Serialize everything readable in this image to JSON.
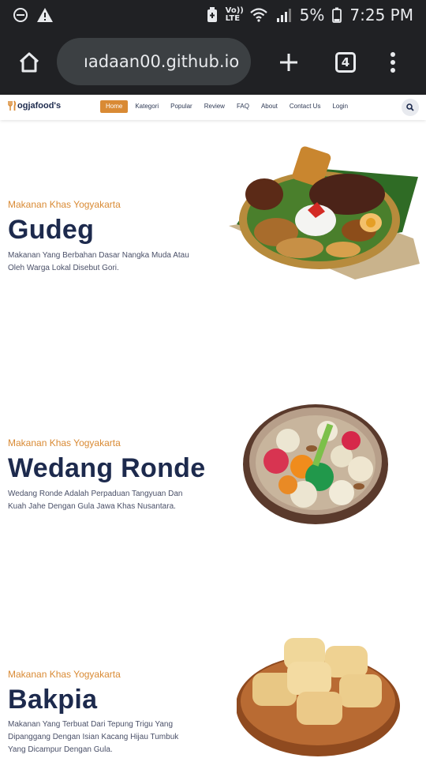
{
  "status_bar": {
    "time": "7:25 PM",
    "battery": "5%",
    "network": "Vo)) LTE",
    "icons": [
      "do-not-disturb-icon",
      "warning-icon",
      "battery-saver-icon",
      "wifi-icon",
      "signal-icon",
      "battery-icon"
    ]
  },
  "browser": {
    "url": "ıadaan00.github.io",
    "tab_count": "4",
    "icons": [
      "home-icon",
      "lock-icon",
      "new-tab-icon",
      "menu-icon"
    ]
  },
  "site": {
    "logo_text": "ogjafood's",
    "nav": [
      "Home",
      "Kategori",
      "Popular",
      "Review",
      "FAQ",
      "About",
      "Contact Us",
      "Login"
    ],
    "active_nav": "Home",
    "accent": "#d98a34",
    "heading_color": "#1d2a4d"
  },
  "sections": [
    {
      "subtitle": "Makanan Khas Yogyakarta",
      "title": "Gudeg",
      "desc_lines": [
        "Makanan Yang Berbahan Dasar Nangka Muda Atau",
        "Oleh Warga Lokal Disebut Gori."
      ]
    },
    {
      "subtitle": "Makanan Khas Yogyakarta",
      "title": "Wedang Ronde",
      "desc_lines": [
        "Wedang Ronde Adalah Perpaduan Tangyuan Dan",
        "Kuah Jahe Dengan Gula Jawa Khas Nusantara."
      ]
    },
    {
      "subtitle": "Makanan Khas Yogyakarta",
      "title": "Bakpia",
      "desc_lines": [
        "Makanan Yang Terbuat Dari Tepung Trigu Yang",
        "Dipanggang Dengan Isian Kacang Hijau Tumbuk",
        "Yang Dicampur Dengan Gula."
      ]
    }
  ]
}
